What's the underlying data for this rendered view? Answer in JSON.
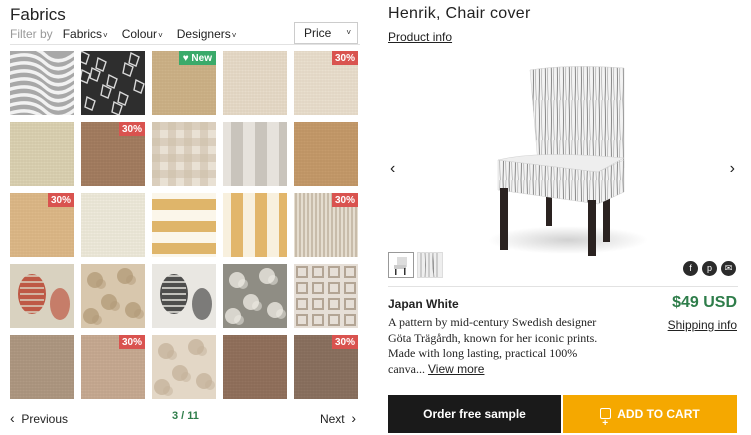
{
  "left": {
    "title": "Fabrics",
    "filter_by": "Filter by",
    "filters": [
      {
        "label": "Fabrics",
        "chevron": "˅"
      },
      {
        "label": "Colour",
        "chevron": "˅"
      },
      {
        "label": "Designers",
        "chevron": "˅"
      }
    ],
    "price_select": {
      "label": "Price",
      "chevron": "˅"
    },
    "tiles": [
      {
        "badge": "",
        "new": false,
        "pattern": "zebra",
        "bg": "#a8a8a8",
        "fg": "#f2f2f2"
      },
      {
        "badge": "",
        "new": false,
        "pattern": "abstract",
        "bg": "#2e2e2e",
        "fg": "#d8d8d8"
      },
      {
        "badge": "",
        "new": true,
        "pattern": "weave",
        "bg": "#cdb38a",
        "fg": "#bfa377"
      },
      {
        "badge": "",
        "new": false,
        "pattern": "weave",
        "bg": "#e7dccb",
        "fg": "#d6c8b3"
      },
      {
        "badge": "30%",
        "new": false,
        "pattern": "weave",
        "bg": "#e9dfcf",
        "fg": "#d9ccb8"
      },
      {
        "badge": "",
        "new": false,
        "pattern": "weave",
        "bg": "#dcd3b5",
        "fg": "#c7bd9b"
      },
      {
        "badge": "30%",
        "new": false,
        "pattern": "weave",
        "bg": "#a58063",
        "fg": "#936f53"
      },
      {
        "badge": "",
        "new": false,
        "pattern": "check",
        "bg": "#e9e1d4",
        "fg": "#cdbfa9"
      },
      {
        "badge": "",
        "new": false,
        "pattern": "vstripe",
        "bg": "#e6e2dc",
        "fg": "#c9c4bc"
      },
      {
        "badge": "",
        "new": false,
        "pattern": "weave",
        "bg": "#c59b6c",
        "fg": "#b68b5c"
      },
      {
        "badge": "30%",
        "new": false,
        "pattern": "weave",
        "bg": "#dcb98a",
        "fg": "#cfa979"
      },
      {
        "badge": "",
        "new": false,
        "pattern": "weave",
        "bg": "#eeeadc",
        "fg": "#ddd7c4"
      },
      {
        "badge": "",
        "new": false,
        "pattern": "hstripe",
        "bg": "#fbf6ea",
        "fg": "#dfb56a"
      },
      {
        "badge": "",
        "new": false,
        "pattern": "vstripe",
        "bg": "#f8f0de",
        "fg": "#e2b66b"
      },
      {
        "badge": "30%",
        "new": false,
        "pattern": "thinstripe",
        "bg": "#e5ddcf",
        "fg": "#b5a792"
      },
      {
        "badge": "",
        "new": false,
        "pattern": "print",
        "bg": "#d9d2c0",
        "fg": "#b9442f"
      },
      {
        "badge": "",
        "new": false,
        "pattern": "floral",
        "bg": "#d8c7ad",
        "fg": "#b29a77"
      },
      {
        "badge": "",
        "new": false,
        "pattern": "print",
        "bg": "#e9e7e2",
        "fg": "#333333"
      },
      {
        "badge": "",
        "new": false,
        "pattern": "floral",
        "bg": "#8f8d84",
        "fg": "#f0ede6"
      },
      {
        "badge": "",
        "new": false,
        "pattern": "lattice",
        "bg": "#e6dfd7",
        "fg": "#b3a595"
      },
      {
        "badge": "",
        "new": false,
        "pattern": "weave",
        "bg": "#b09a84",
        "fg": "#9f8873"
      },
      {
        "badge": "30%",
        "new": false,
        "pattern": "weave",
        "bg": "#c8ab94",
        "fg": "#b79a83"
      },
      {
        "badge": "",
        "new": false,
        "pattern": "floral",
        "bg": "#e3d7c6",
        "fg": "#c4b29a"
      },
      {
        "badge": "",
        "new": false,
        "pattern": "weave",
        "bg": "#93735f",
        "fg": "#836350"
      },
      {
        "badge": "30%",
        "new": false,
        "pattern": "weave",
        "bg": "#8c7362",
        "fg": "#7c6352"
      }
    ],
    "pager": {
      "prev_arrow": "‹",
      "prev": "Previous",
      "count": "3 / 11",
      "next": "Next",
      "next_arrow": "›"
    }
  },
  "right": {
    "title": "Henrik, Chair cover",
    "product_info": "Product info",
    "nav_prev": "‹",
    "nav_next": "›",
    "share": [
      "f",
      "p",
      "✉"
    ],
    "color_name": "Japan White",
    "price": "$49 USD",
    "shipping": "Shipping info",
    "description": "A pattern by mid-century Swedish designer Göta Trägårdh, known for her iconic prints. Made with long lasting, practical 100% canva...",
    "view_more": "View more",
    "order_sample": "Order free sample",
    "add_to_cart": "ADD TO CART"
  }
}
